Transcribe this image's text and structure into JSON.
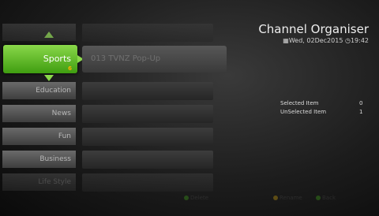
{
  "header": {
    "title": "Channel Organiser",
    "date": "Wed, 02Dec2015",
    "time": "19:42"
  },
  "categories": [
    {
      "label": "Sports",
      "badge": "6"
    },
    {
      "label": "Education"
    },
    {
      "label": "News"
    },
    {
      "label": "Fun"
    },
    {
      "label": "Business"
    },
    {
      "label": "Life Style"
    }
  ],
  "channels": [
    {
      "label": "013 TVNZ Pop-Up"
    }
  ],
  "info": {
    "selected_label": "Selected Item",
    "selected_value": "0",
    "unselected_label": "UnSelected Item",
    "unselected_value": "1"
  },
  "help": {
    "delete": "Delete",
    "rename": "Rename",
    "back": "Back"
  },
  "colors": {
    "accent": "#6fbf2f",
    "background": "#1c1c1c"
  }
}
